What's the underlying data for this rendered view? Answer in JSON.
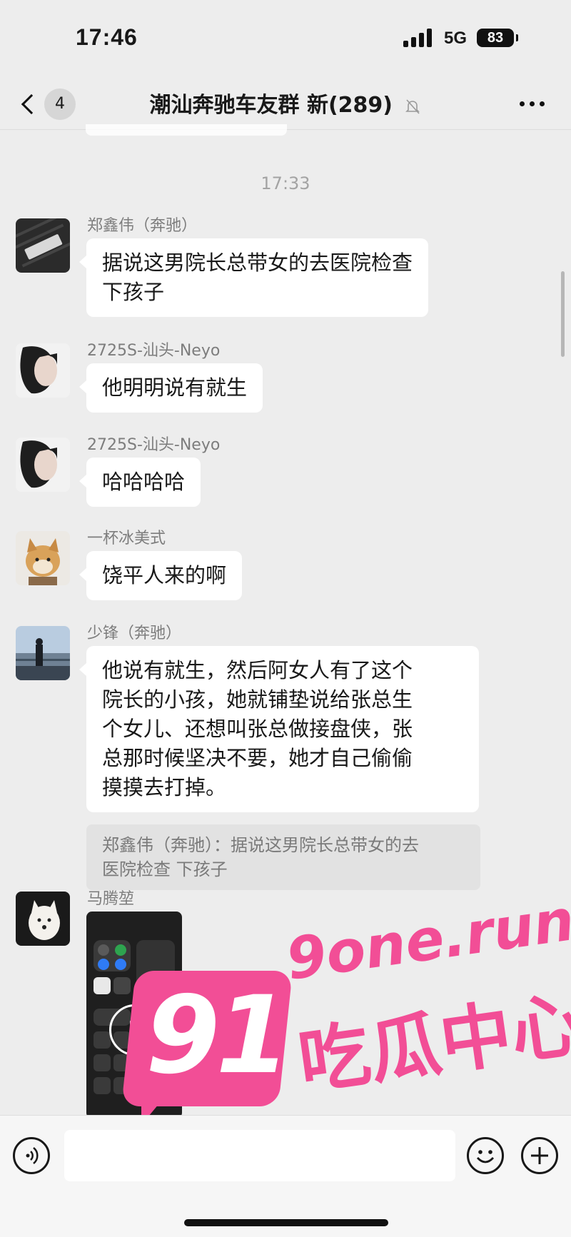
{
  "status_bar": {
    "time": "17:46",
    "network": "5G",
    "battery": "83"
  },
  "nav": {
    "back_count": "4",
    "title": "潮汕奔驰车友群 新(289)",
    "icons": {
      "back": "chevron-left-icon",
      "mute": "bell-off-icon",
      "more": "more-dots-icon"
    }
  },
  "chat": {
    "timestamp": "17:33",
    "messages": [
      {
        "sender": "郑鑫伟（奔驰）",
        "lines": [
          "据说这男院长总带女的去医院检查",
          "下孩子"
        ]
      },
      {
        "sender": "2725S-汕头-Neyo",
        "lines": [
          "他明明说有就生"
        ]
      },
      {
        "sender": "2725S-汕头-Neyo",
        "lines": [
          "哈哈哈哈"
        ]
      },
      {
        "sender": "一杯冰美式",
        "lines": [
          "饶平人来的啊"
        ]
      },
      {
        "sender": "少锋（奔驰）",
        "lines": [
          "他说有就生，然后阿女人有了这个",
          "院长的小孩，她就铺垫说给张总生",
          "个女儿、还想叫张总做接盘侠，张",
          "总那时候坚决不要，她才自己偷偷",
          "摸摸去打掉。"
        ],
        "quote_lines": [
          "郑鑫伟（奔驰）：据说这男院长总带女的去",
          "医院检查 下孩子"
        ]
      },
      {
        "sender": "马腾堃",
        "type": "video",
        "icon": "play-icon"
      }
    ]
  },
  "input_bar": {
    "icons": {
      "voice": "voice-icon",
      "emoji": "emoji-icon",
      "plus": "plus-icon"
    }
  },
  "watermark": {
    "number": "91",
    "domain": "9one.run",
    "text": "吃瓜中心"
  }
}
